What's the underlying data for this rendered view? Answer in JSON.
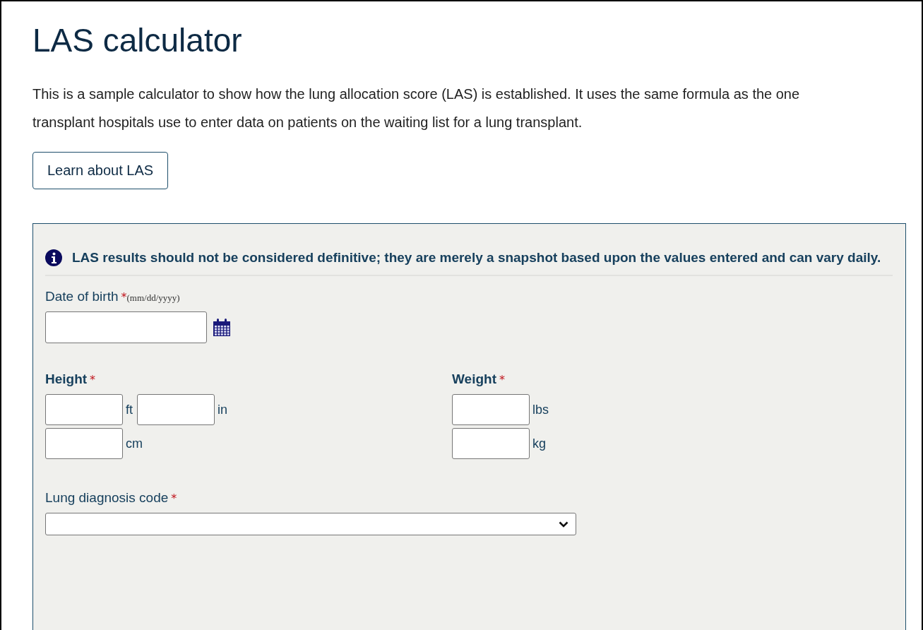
{
  "title": "LAS calculator",
  "intro": "This is a sample calculator to show how the lung allocation score (LAS) is established. It uses the same formula as the one transplant hospitals use to enter data on patients on the waiting list for a lung transplant.",
  "learn_button": "Learn about LAS",
  "notice": "LAS results should not be considered definitive; they are merely a snapshot based upon the values entered and can vary daily.",
  "date_of_birth": {
    "label": "Date of birth",
    "required_mark": "*",
    "hint": "(mm/dd/yyyy)"
  },
  "height": {
    "label": "Height",
    "required_mark": "*",
    "rows": [
      [
        "ft",
        "in"
      ],
      [
        "cm"
      ]
    ]
  },
  "weight": {
    "label": "Weight",
    "required_mark": "*",
    "rows": [
      [
        "lbs"
      ],
      [
        "kg"
      ]
    ]
  },
  "diagnosis": {
    "label": "Lung diagnosis code",
    "required_mark": "*"
  }
}
